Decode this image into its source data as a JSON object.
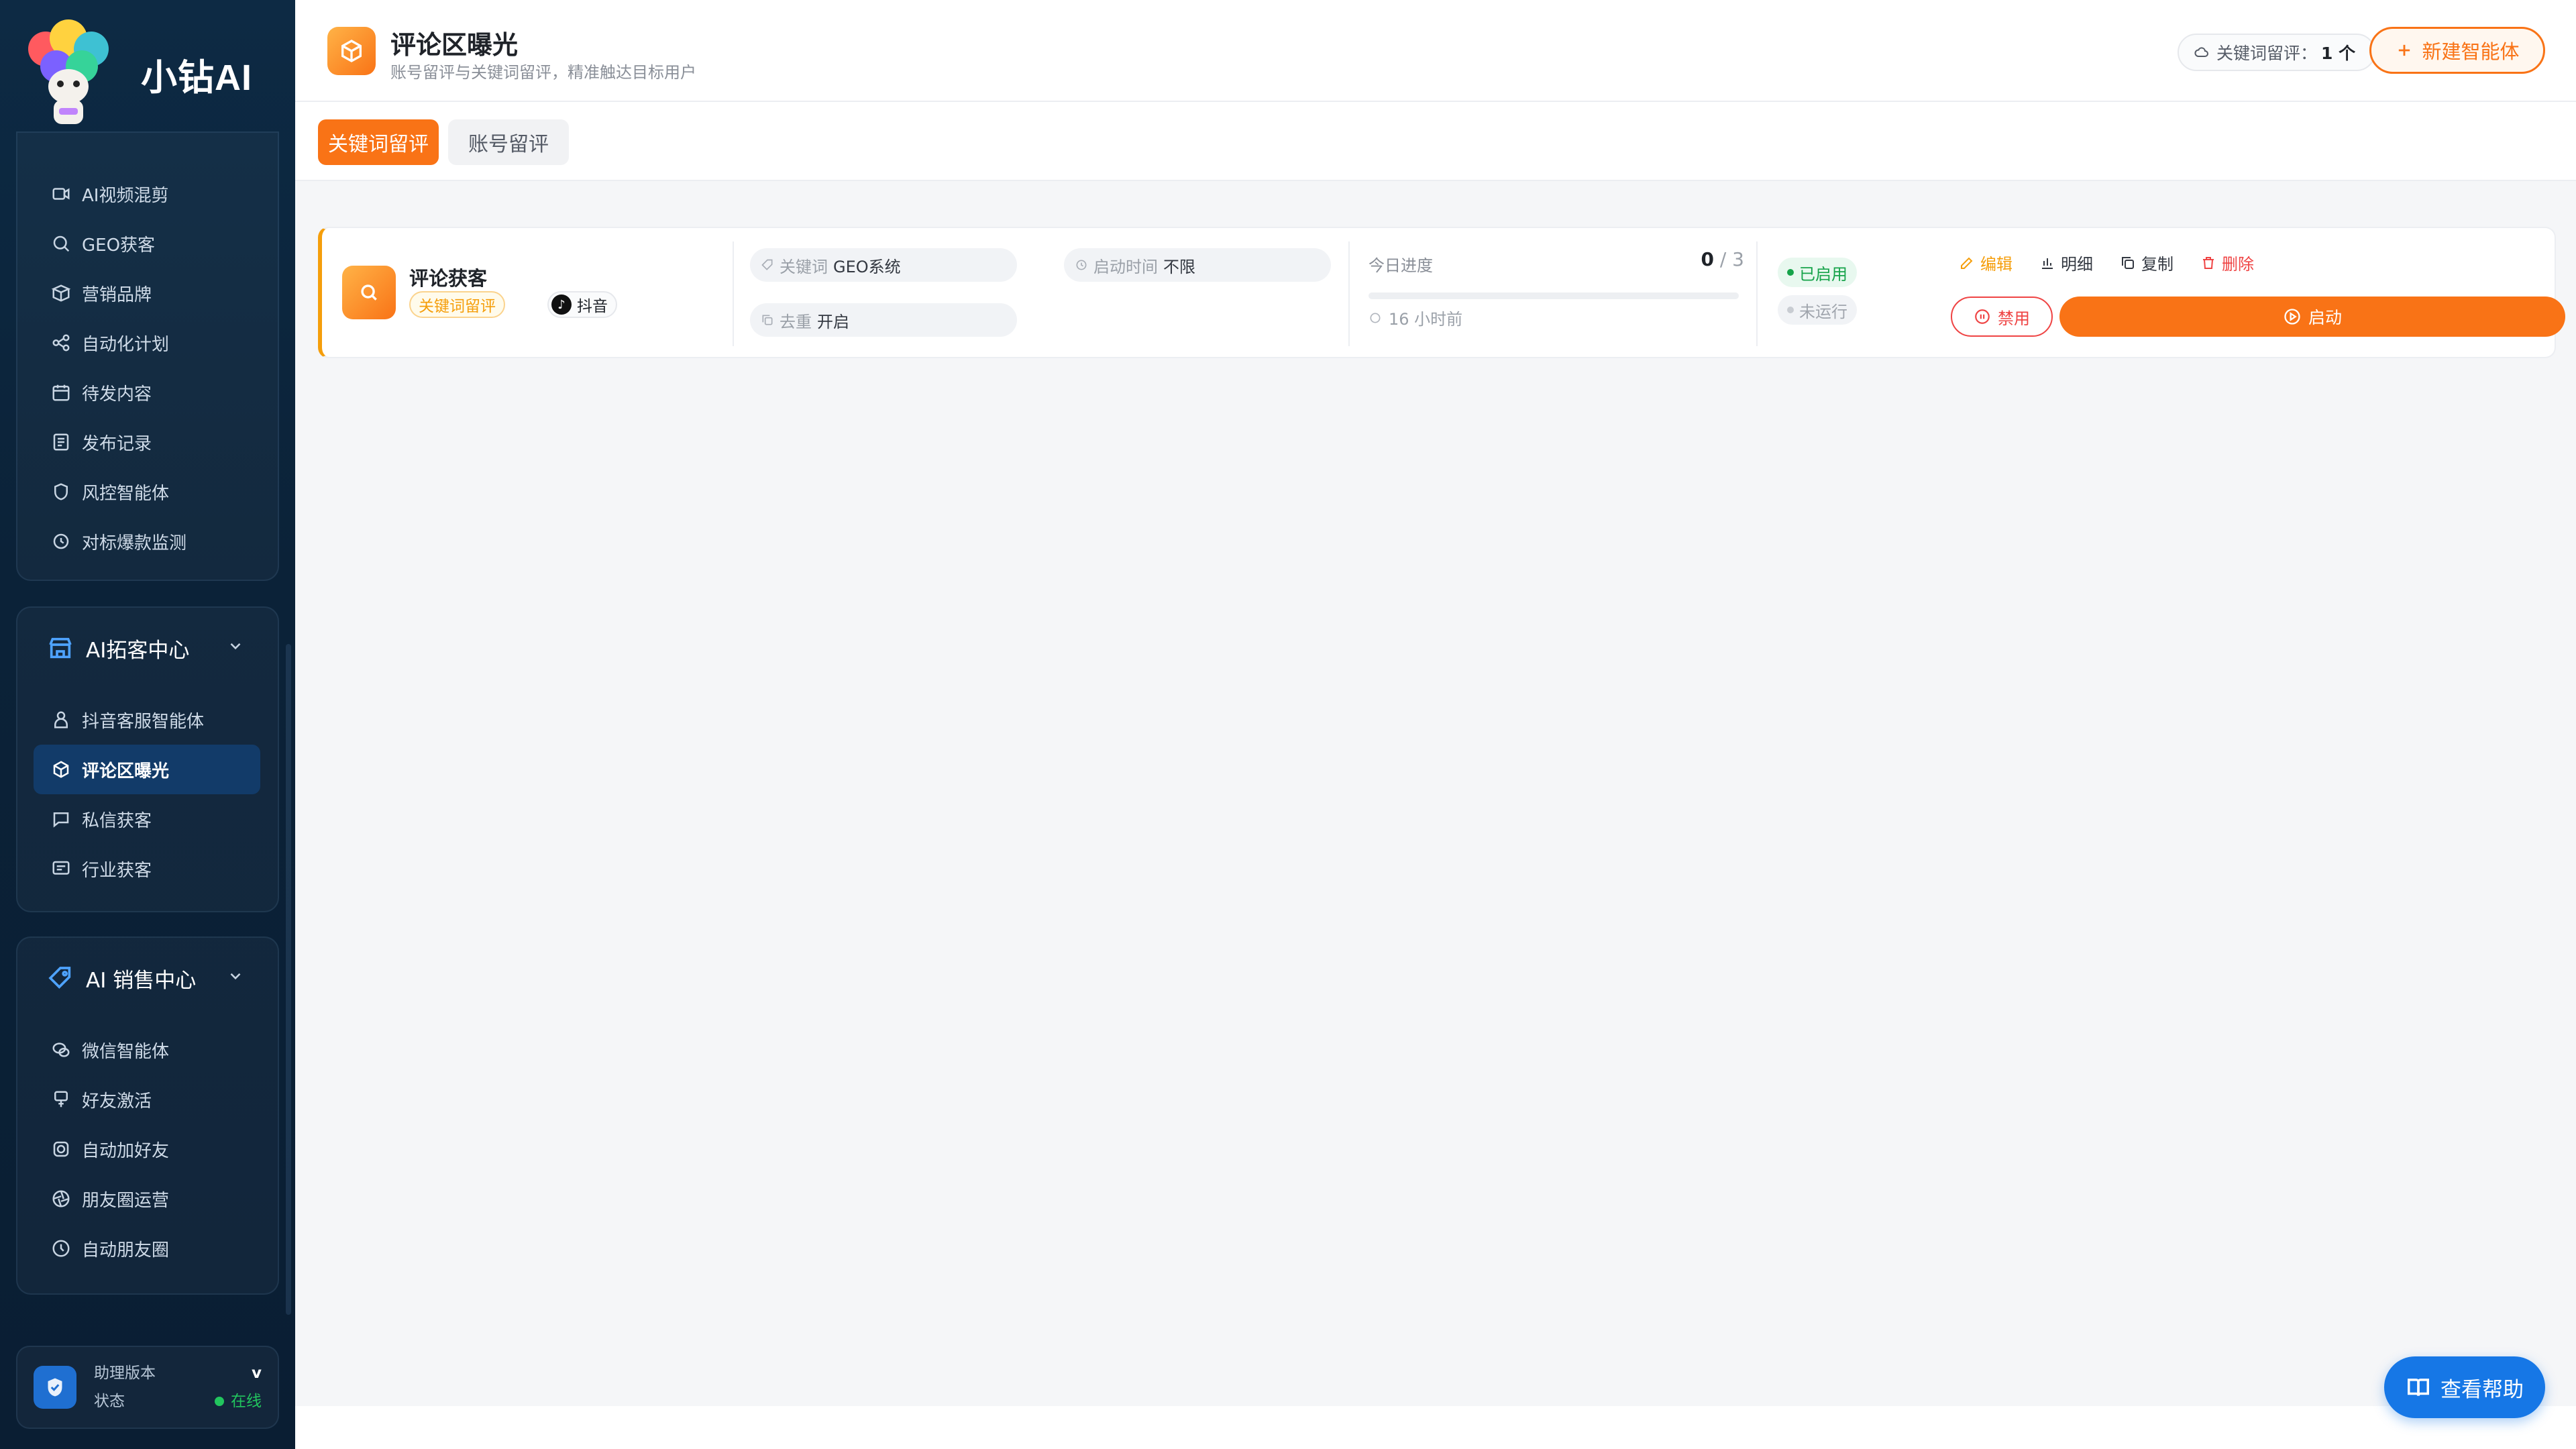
{
  "brand": {
    "name": "小钻AI"
  },
  "sidebar": {
    "top_items": [
      {
        "label": "AI视频混剪",
        "icon": "video-icon"
      },
      {
        "label": "GEO获客",
        "icon": "search-icon"
      },
      {
        "label": "营销品牌",
        "icon": "box-icon"
      },
      {
        "label": "自动化计划",
        "icon": "share-icon"
      },
      {
        "label": "待发内容",
        "icon": "calendar-icon"
      },
      {
        "label": "发布记录",
        "icon": "list-icon"
      },
      {
        "label": "风控智能体",
        "icon": "shield-icon"
      },
      {
        "label": "对标爆款监测",
        "icon": "monitor-icon"
      }
    ],
    "group_acquire": {
      "title": "AI拓客中心",
      "items": [
        {
          "label": "抖音客服智能体",
          "icon": "agent-icon"
        },
        {
          "label": "评论区曝光",
          "icon": "cube-icon"
        },
        {
          "label": "私信获客",
          "icon": "message-icon"
        },
        {
          "label": "行业获客",
          "icon": "chat-icon"
        }
      ]
    },
    "group_sales": {
      "title": "AI 销售中心",
      "items": [
        {
          "label": "微信智能体",
          "icon": "wechat-icon"
        },
        {
          "label": "好友激活",
          "icon": "flag-icon"
        },
        {
          "label": "自动加好友",
          "icon": "add-user-icon"
        },
        {
          "label": "朋友圈运营",
          "icon": "aperture-icon"
        },
        {
          "label": "自动朋友圈",
          "icon": "clock-icon"
        }
      ]
    },
    "status": {
      "title": "助理版本",
      "label": "状态",
      "version": "v",
      "online": "在线"
    }
  },
  "header": {
    "title": "评论区曝光",
    "subtitle": "账号留评与关键词留评，精准触达目标用户",
    "keyword_chip_label": "关键词留评：",
    "keyword_chip_count": "1 个",
    "new_button": "新建智能体"
  },
  "tabs": [
    {
      "label": "关键词留评",
      "active": true
    },
    {
      "label": "账号留评",
      "active": false
    }
  ],
  "agent": {
    "name": "评论获客",
    "tag": "关键词留评",
    "platform": "抖音",
    "keyword_label": "关键词",
    "keyword_value": "GEO系统",
    "start_time_label": "启动时间",
    "start_time_value": "不限",
    "dedupe_label": "去重",
    "dedupe_value": "开启",
    "progress_label": "今日进度",
    "progress_done": "0",
    "progress_total": "/ 3",
    "progress_fraction": 0,
    "last_run": "16 小时前",
    "status_enabled": "已启用",
    "status_running": "未运行",
    "actions": {
      "edit": "编辑",
      "detail": "明细",
      "copy": "复制",
      "delete": "删除"
    },
    "disable_button": "禁用",
    "start_button": "启动"
  },
  "help_button": "查看帮助",
  "colors": {
    "accent": "#f97316",
    "sidebar_bg": "#0b2238",
    "help": "#1677e6",
    "success": "#16a34a",
    "danger": "#ef4444"
  }
}
